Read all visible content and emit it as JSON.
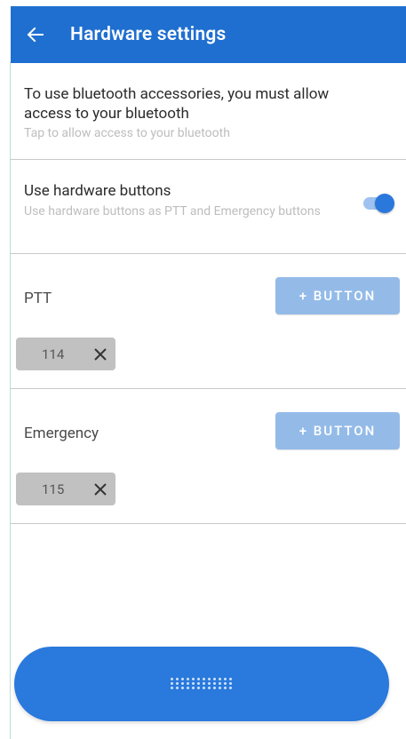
{
  "app_bar": {
    "title": "Hardware settings",
    "back_icon": "arrow-left-icon",
    "color": "#1f6fd0"
  },
  "bluetooth": {
    "title": "To use bluetooth accessories, you must allow access to your bluetooth",
    "subtitle": "Tap to allow access to your bluetooth"
  },
  "hardware_buttons": {
    "title": "Use hardware buttons",
    "subtitle": "Use hardware buttons as PTT and Emergency buttons",
    "toggle_on": true
  },
  "ptt": {
    "label": "PTT",
    "add_button_label": "+ BUTTON",
    "keys": [
      {
        "value": "114"
      }
    ]
  },
  "emergency": {
    "label": "Emergency",
    "add_button_label": "+ BUTTON",
    "keys": [
      {
        "value": "115"
      }
    ]
  },
  "bottom_action": {
    "icon": "dotted-pattern-icon",
    "color": "#2a79dc"
  }
}
